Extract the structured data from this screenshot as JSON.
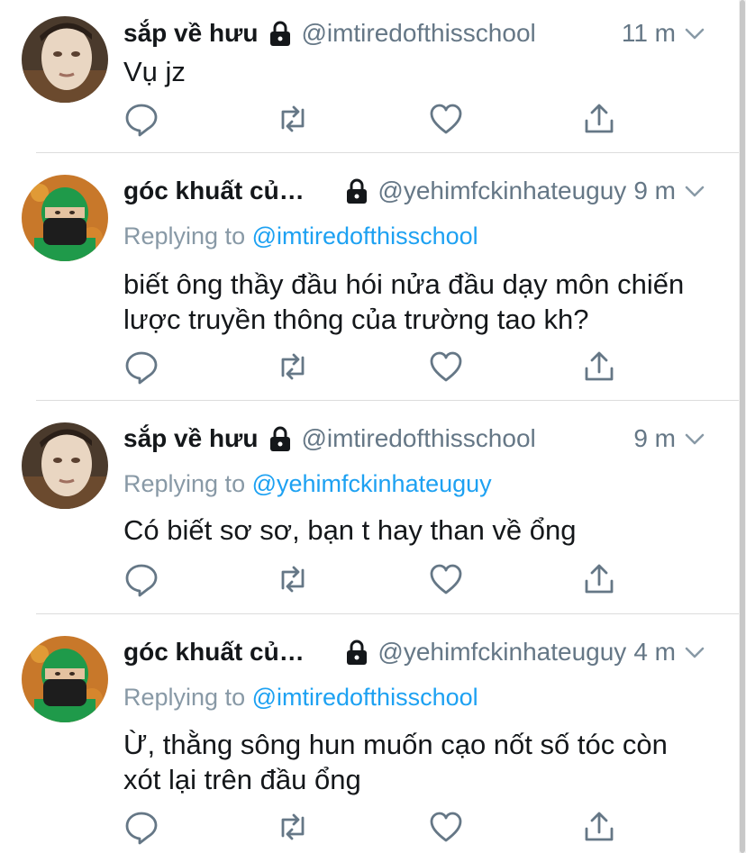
{
  "tweets": [
    {
      "display_name": "sắp về hưu",
      "handle": "@imtiredofthisschool",
      "time": "11 m",
      "replying_label": "",
      "replying_to": "",
      "text": "Vụ jz"
    },
    {
      "display_name": "góc khuất của...",
      "handle": "@yehimfckinhateuguy",
      "time": "9 m",
      "replying_label": "Replying to",
      "replying_to": "@imtiredofthisschool",
      "text_lines": [
        "biết ông thầy đầu hói nửa đầu dạy môn chiến",
        "lược truyền thông của trường tao kh?"
      ]
    },
    {
      "display_name": "sắp về hưu",
      "handle": "@imtiredofthisschool",
      "time": "9 m",
      "replying_label": "Replying to",
      "replying_to": "@yehimfckinhateuguy",
      "text": "Có biết sơ sơ, bạn t hay than về ổng"
    },
    {
      "display_name": "góc khuất của...",
      "handle": "@yehimfckinhateuguy",
      "time": "4 m",
      "replying_label": "Replying to",
      "replying_to": "@imtiredofthisschool",
      "text_lines": [
        "Ừ, thằng sông hun muốn cạo nốt số tóc còn",
        "xót lại trên đầu ổng"
      ]
    }
  ],
  "icons": {
    "lock": "lock-icon",
    "chevron": "chevron-down-icon",
    "reply": "reply-icon",
    "retweet": "retweet-icon",
    "like": "heart-icon",
    "share": "share-icon"
  },
  "colors": {
    "name": "#14171a",
    "handle": "#657786",
    "mention": "#1da1f2",
    "icon": "#657786",
    "divider": "#dcdcdc"
  }
}
